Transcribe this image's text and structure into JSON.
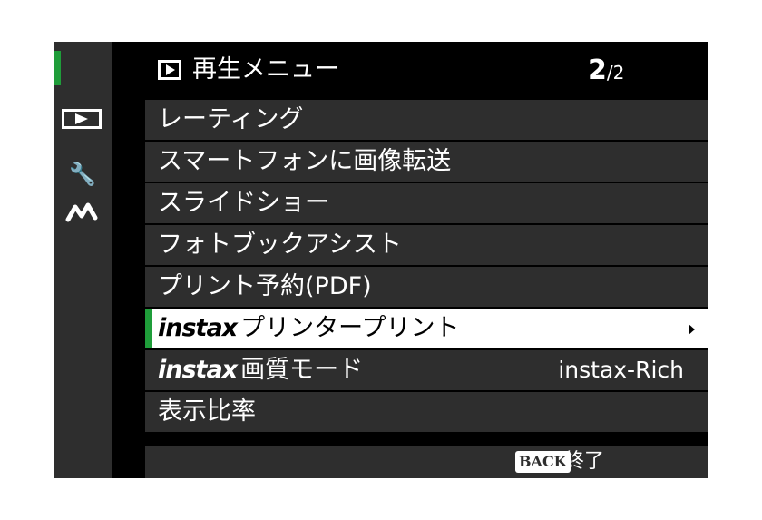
{
  "header": {
    "title": "再生メニュー",
    "page_current": "2",
    "page_total": "/2"
  },
  "menu": {
    "items": [
      {
        "prefix": "",
        "label": "レーティング",
        "value": ""
      },
      {
        "prefix": "",
        "label": "スマートフォンに画像転送",
        "value": ""
      },
      {
        "prefix": "",
        "label": "スライドショー",
        "value": ""
      },
      {
        "prefix": "",
        "label": "フォトブックアシスト",
        "value": ""
      },
      {
        "prefix": "",
        "label": "プリント予約(PDF)",
        "value": ""
      },
      {
        "prefix": "instax",
        "label": "プリンタープリント",
        "value": "",
        "selected": true
      },
      {
        "prefix": "instax",
        "label": "画質モード",
        "value": "instax-Rich"
      },
      {
        "prefix": "",
        "label": "表示比率",
        "value": ""
      }
    ]
  },
  "footer": {
    "back_badge": "BACK",
    "back_label": "終了"
  },
  "sidebar": {
    "icons": [
      "playback-icon",
      "wrench-icon",
      "connection-icon"
    ]
  },
  "colors": {
    "accent": "#1f9d3a",
    "row_bg": "#2e2e2e",
    "selected_bg": "#ffffff"
  }
}
